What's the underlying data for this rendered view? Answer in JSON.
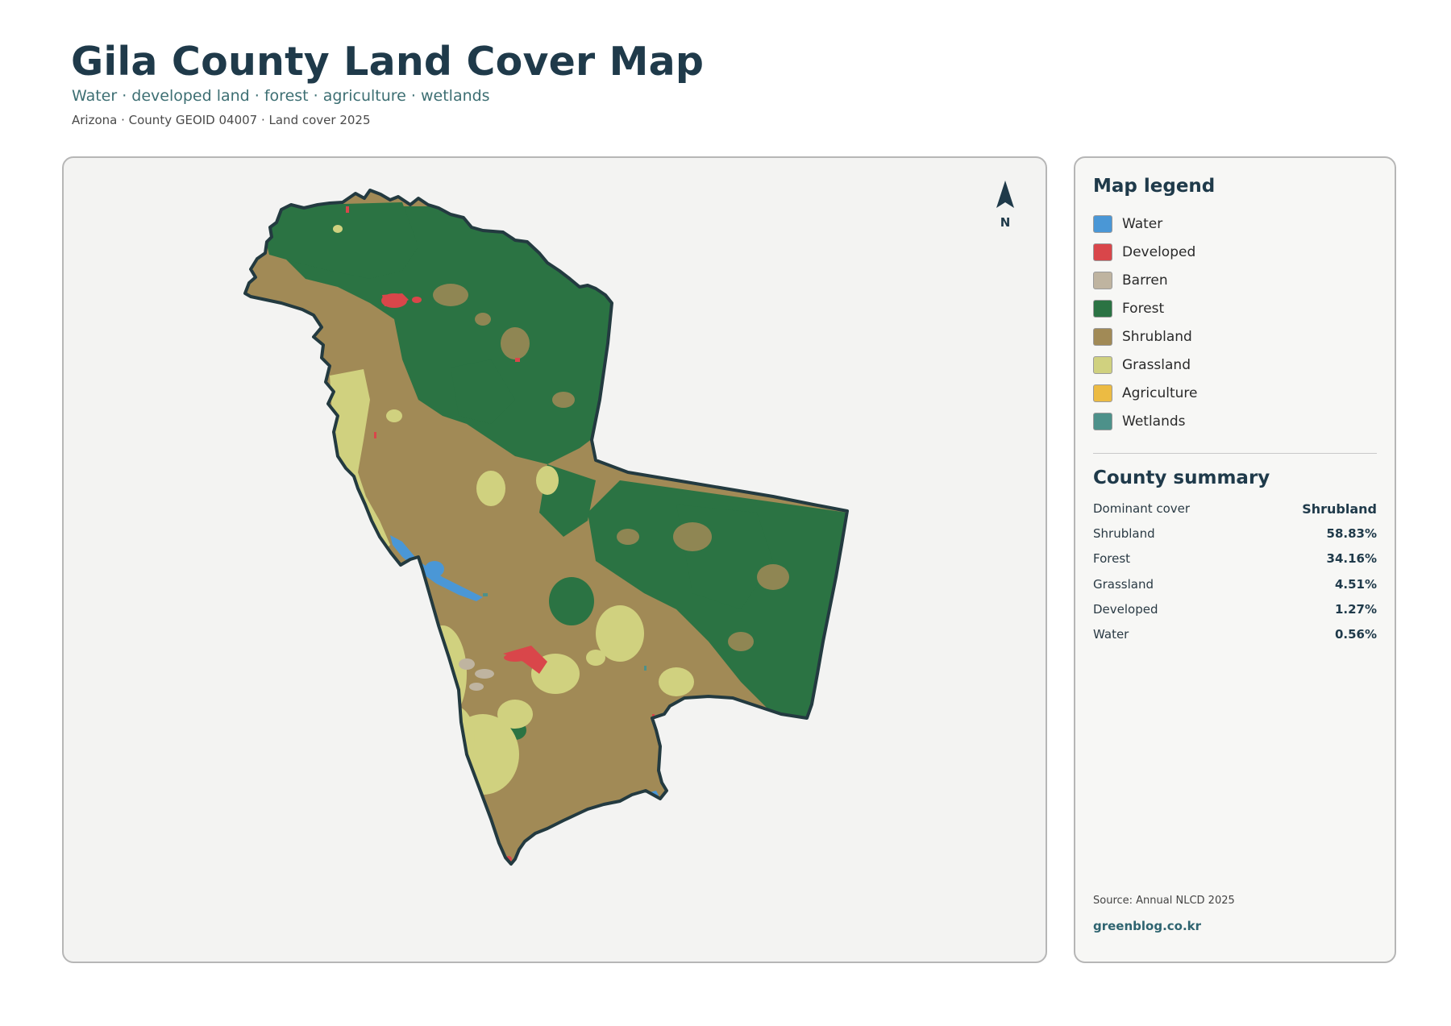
{
  "header": {
    "title": "Gila County Land Cover Map",
    "subtitle": "Water · developed land · forest · agriculture · wetlands",
    "meta": "Arizona · County GEOID 04007 · Land cover 2025"
  },
  "map": {
    "north_label": "N",
    "colors": {
      "water": "#4a97d6",
      "developed": "#d9464a",
      "barren": "#bfb4a0",
      "forest": "#2b7343",
      "shrubland": "#a18a56",
      "grassland": "#d0d17f",
      "outline": "#233a40",
      "background": "#f3f3f2"
    }
  },
  "legend": {
    "heading": "Map legend",
    "items": [
      {
        "label": "Water",
        "color": "#4a97d6"
      },
      {
        "label": "Developed",
        "color": "#d9464a"
      },
      {
        "label": "Barren",
        "color": "#bfb4a0"
      },
      {
        "label": "Forest",
        "color": "#2b7343"
      },
      {
        "label": "Shrubland",
        "color": "#a18a56"
      },
      {
        "label": "Grassland",
        "color": "#d0d17f"
      },
      {
        "label": "Agriculture",
        "color": "#ecbb43"
      },
      {
        "label": "Wetlands",
        "color": "#4d918a"
      }
    ]
  },
  "summary": {
    "heading": "County summary",
    "rows": [
      {
        "label": "Dominant cover",
        "value": "Shrubland"
      },
      {
        "label": "Shrubland",
        "value": "58.83%"
      },
      {
        "label": "Forest",
        "value": "34.16%"
      },
      {
        "label": "Grassland",
        "value": "4.51%"
      },
      {
        "label": "Developed",
        "value": "1.27%"
      },
      {
        "label": "Water",
        "value": "0.56%"
      }
    ]
  },
  "footer": {
    "source": "Source: Annual NLCD 2025",
    "site": "greenblog.co.kr"
  }
}
